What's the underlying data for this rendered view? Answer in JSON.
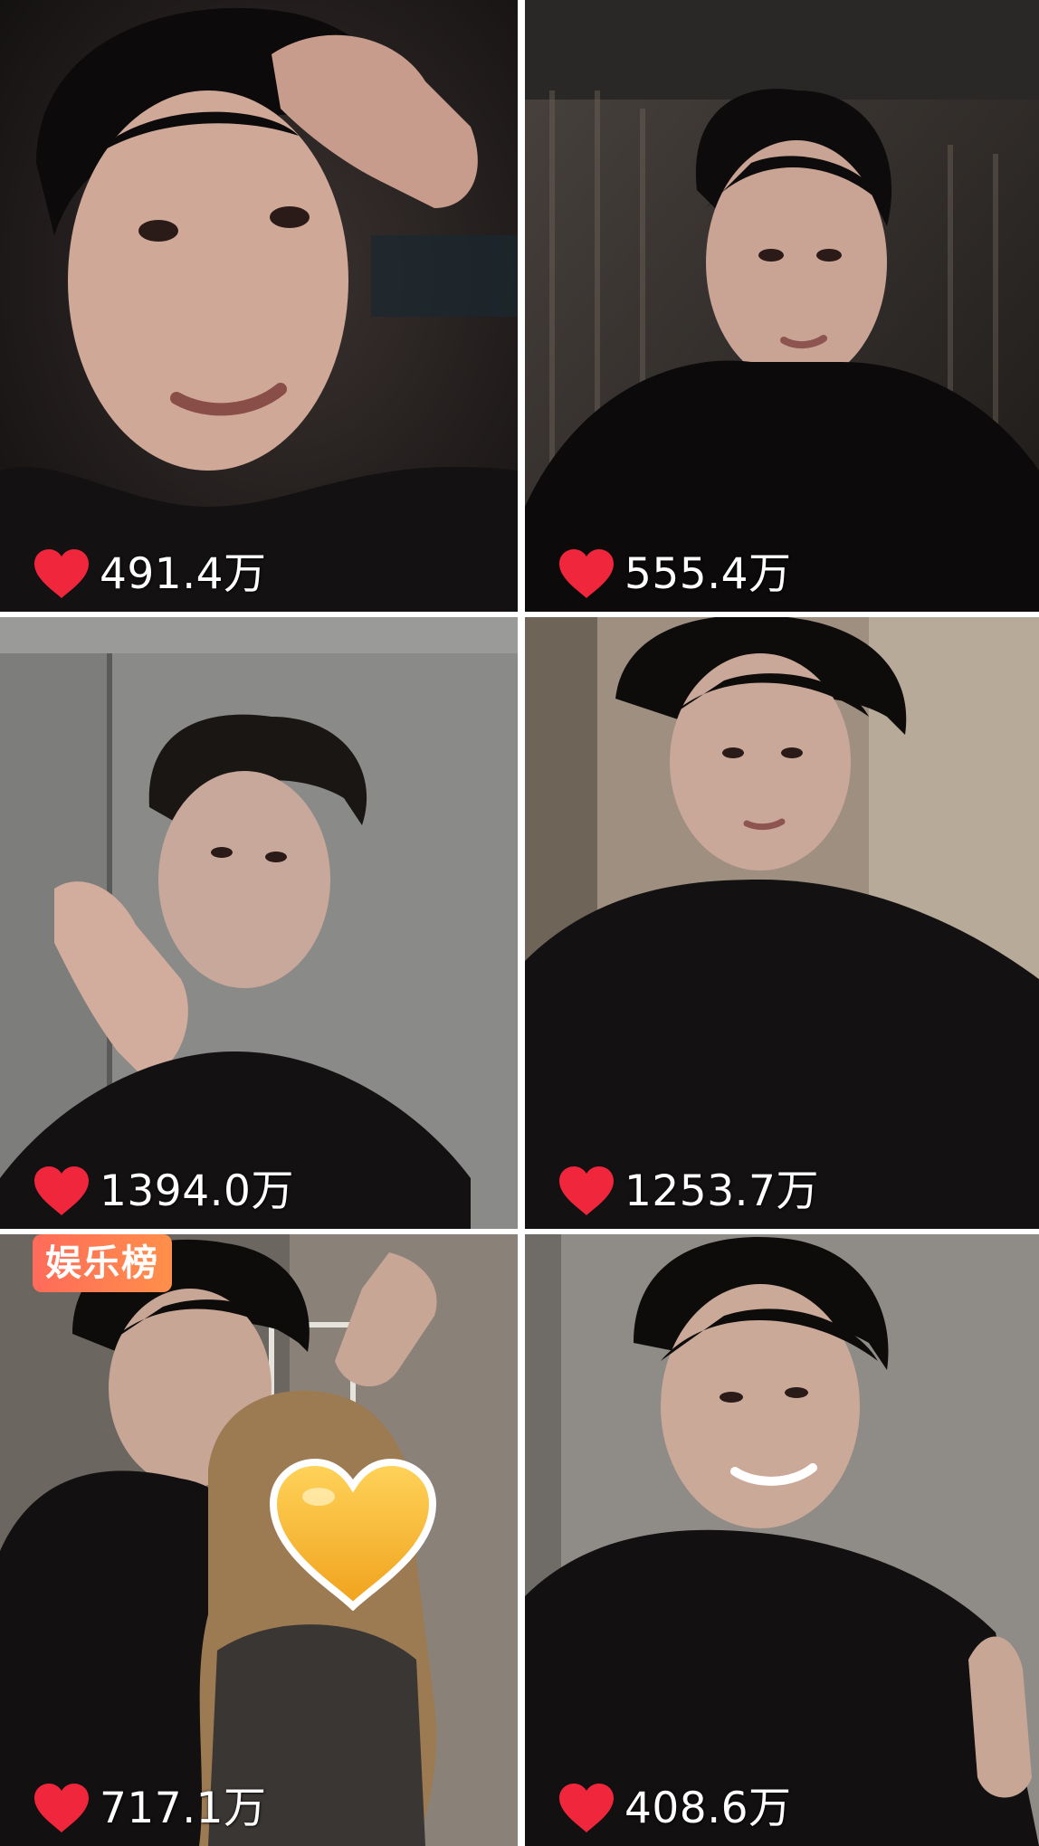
{
  "tiles": [
    {
      "likes": "491.4万",
      "badge": ""
    },
    {
      "likes": "555.4万",
      "badge": ""
    },
    {
      "likes": "1394.0万",
      "badge": ""
    },
    {
      "likes": "1253.7万",
      "badge": ""
    },
    {
      "likes": "717.1万",
      "badge": "娱乐榜"
    },
    {
      "likes": "408.6万",
      "badge": ""
    }
  ],
  "icons": {
    "like": "heart-icon",
    "overlay": "gold-heart-emoji"
  },
  "colors": {
    "heart": "#f0263c",
    "badge_start": "#ff6b5a",
    "badge_end": "#ff8f4a",
    "divider": "#ffffff",
    "gold_heart": "#f6b92a"
  }
}
